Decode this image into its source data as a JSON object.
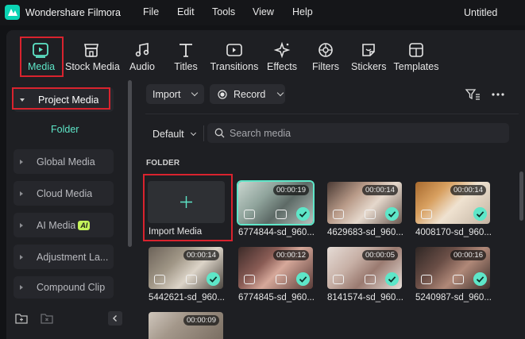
{
  "app": {
    "name": "Wondershare Filmora",
    "document_title": "Untitled",
    "menu": [
      "File",
      "Edit",
      "Tools",
      "View",
      "Help"
    ]
  },
  "tabs": [
    {
      "id": "media",
      "label": "Media",
      "icon": "media-icon",
      "active": true
    },
    {
      "id": "stock-media",
      "label": "Stock Media",
      "icon": "stock-media-icon"
    },
    {
      "id": "audio",
      "label": "Audio",
      "icon": "music-note-icon"
    },
    {
      "id": "titles",
      "label": "Titles",
      "icon": "titles-t-icon"
    },
    {
      "id": "transitions",
      "label": "Transitions",
      "icon": "transitions-icon"
    },
    {
      "id": "effects",
      "label": "Effects",
      "icon": "effects-sparkle-icon"
    },
    {
      "id": "filters",
      "label": "Filters",
      "icon": "filters-icon"
    },
    {
      "id": "stickers",
      "label": "Stickers",
      "icon": "stickers-icon"
    },
    {
      "id": "templates",
      "label": "Templates",
      "icon": "templates-icon"
    }
  ],
  "sidebar": {
    "project_media": "Project Media",
    "folder": "Folder",
    "items": [
      "Global Media",
      "Cloud Media",
      "AI Media",
      "Adjustment La...",
      "Compound Clip"
    ],
    "ai_badge": "AI"
  },
  "toolbar": {
    "import_label": "Import",
    "record_label": "Record"
  },
  "filter": {
    "sort_label": "Default",
    "search_placeholder": "Search media"
  },
  "folder_label": "FOLDER",
  "import_media_label": "Import Media",
  "clips": [
    {
      "name": "6774844-sd_960...",
      "duration": "00:00:19",
      "selected": true
    },
    {
      "name": "4629683-sd_960...",
      "duration": "00:00:14"
    },
    {
      "name": "4008170-sd_960...",
      "duration": "00:00:14"
    },
    {
      "name": "5442621-sd_960...",
      "duration": "00:00:14"
    },
    {
      "name": "6774845-sd_960...",
      "duration": "00:00:12"
    },
    {
      "name": "8141574-sd_960...",
      "duration": "00:00:05"
    },
    {
      "name": "5240987-sd_960...",
      "duration": "00:00:16"
    },
    {
      "name": "",
      "duration": "00:00:09"
    }
  ],
  "colors": {
    "accent": "#5ee6c8",
    "highlight_box": "#d9232e",
    "background": "#1e1f23"
  }
}
